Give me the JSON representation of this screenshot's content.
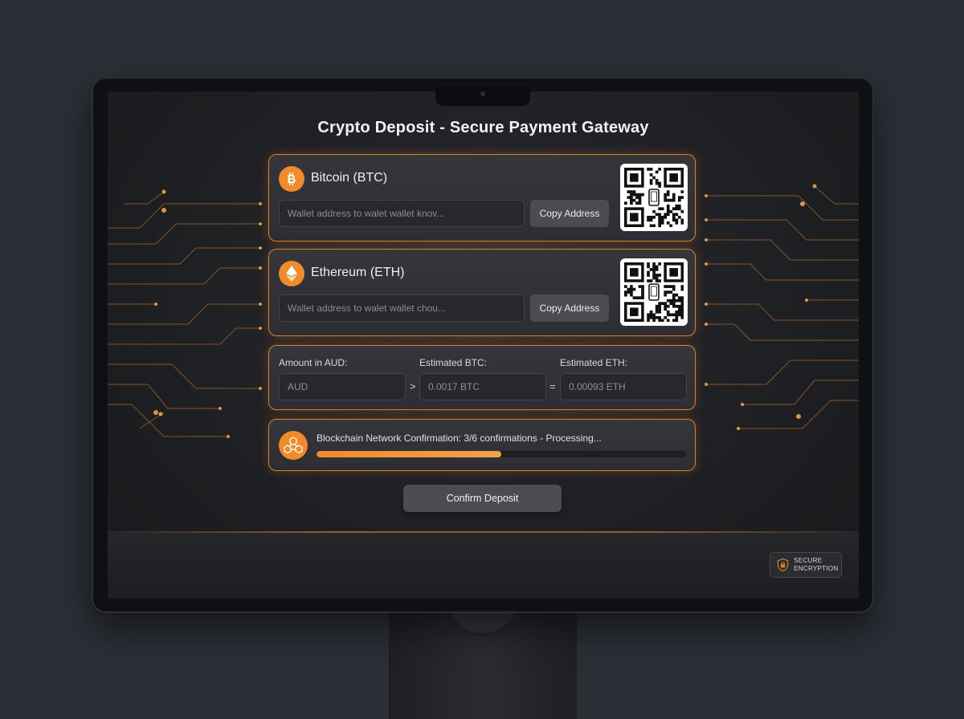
{
  "page": {
    "title": "Crypto Deposit - Secure Payment Gateway"
  },
  "btc": {
    "name": "Bitcoin (BTC)",
    "address_placeholder": "Wallet address to walet wallet knov...",
    "copy_label": "Copy Address"
  },
  "eth": {
    "name": "Ethereum (ETH)",
    "address_placeholder": "Wallet address to walet wallet chou...",
    "copy_label": "Copy Address"
  },
  "calculator": {
    "aud_label": "Amount in AUD:",
    "aud_placeholder": "AUD",
    "btc_label": "Estimated BTC:",
    "btc_placeholder": "0.0017 BTC",
    "eth_label": "Estimated ETH:",
    "eth_placeholder": "0.00093 ETH",
    "op_1": ">",
    "op_2": "="
  },
  "status": {
    "text": "Blockchain Network Confirmation: 3/6 confirmations - Processing...",
    "progress_fraction": 0.5
  },
  "actions": {
    "confirm_label": "Confirm Deposit"
  },
  "badge": {
    "line1": "SECURE",
    "line2": "ENCRYPTION"
  },
  "colors": {
    "accent": "#f08a2a",
    "card_border": "#d9802d"
  },
  "icons": {
    "btc": "bitcoin-icon",
    "eth": "ethereum-icon",
    "status": "blockchain-network-icon",
    "badge": "shield-lock-icon",
    "qr": "qr-code-icon"
  }
}
